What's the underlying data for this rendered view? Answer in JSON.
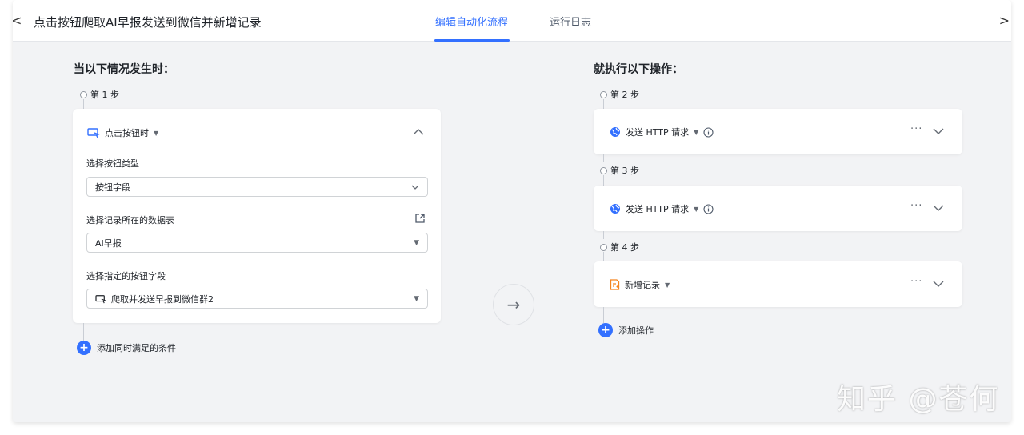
{
  "header": {
    "title": "点击按钮爬取AI早报发送到微信并新增记录",
    "tabs": [
      {
        "label": "编辑自动化流程",
        "active": true
      },
      {
        "label": "运行日志",
        "active": false
      }
    ]
  },
  "trigger": {
    "section_title": "当以下情况发生时：",
    "step_label": "第 1 步",
    "card_title": "点击按钮时",
    "fields": [
      {
        "label": "选择按钮类型",
        "value": "按钮字段"
      },
      {
        "label": "选择记录所在的数据表",
        "value": "AI早报"
      },
      {
        "label": "选择指定的按钮字段",
        "value": "爬取并发送早报到微信群2"
      }
    ],
    "add_condition": "添加同时满足的条件"
  },
  "actions": {
    "section_title": "就执行以下操作：",
    "steps": [
      {
        "step_label": "第 2 步",
        "title": "发送 HTTP 请求"
      },
      {
        "step_label": "第 3 步",
        "title": "发送 HTTP 请求"
      },
      {
        "step_label": "第 4 步",
        "title": "新增记录"
      }
    ],
    "add_action": "添加操作"
  },
  "watermark": "知乎 @苍何",
  "colors": {
    "accent": "#3370ff",
    "background": "#f2f3f5",
    "record_icon": "#f5851f"
  },
  "icons": {
    "back": "chevron-left-icon",
    "forward": "chevron-right-icon",
    "trigger": "button-cursor-icon",
    "http": "globe-icon",
    "record": "add-record-icon",
    "info": "info-icon",
    "external": "open-external-icon"
  }
}
